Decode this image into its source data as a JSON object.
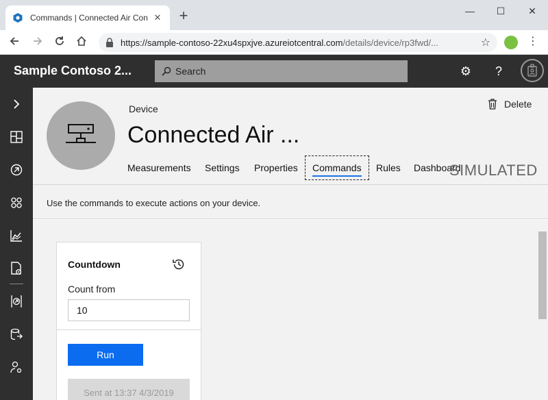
{
  "browser": {
    "tab_title": "Commands | Connected Air Conditioner",
    "new_tab_symbol": "+",
    "close_symbol": "✕",
    "url_host": "https://sample-contoso-22xu4spxjve.azureiotcentral.com",
    "url_path": "/details/device/rp3fwd/...",
    "window_controls": [
      "—",
      "☐",
      "✕"
    ]
  },
  "app": {
    "brand": "Sample Contoso 2...",
    "search_placeholder": "Search",
    "accent_color": "#0b6cf0",
    "header_bg": "#2f2f2f"
  },
  "rail": {
    "items": [
      "expand-icon",
      "dashboard-icon",
      "devices-icon",
      "device-sets-icon",
      "analytics-icon",
      "jobs-icon",
      "device-templates-icon",
      "data-export-icon",
      "administration-icon"
    ]
  },
  "device": {
    "type_label": "Device",
    "name": "Connected Air ...",
    "delete_label": "Delete",
    "badge": "SIMULATED",
    "tabs": [
      {
        "label": "Measurements",
        "active": false
      },
      {
        "label": "Settings",
        "active": false
      },
      {
        "label": "Properties",
        "active": false
      },
      {
        "label": "Commands",
        "active": true
      },
      {
        "label": "Rules",
        "active": false
      },
      {
        "label": "Dashboard",
        "active": false
      }
    ]
  },
  "commands": {
    "description": "Use the commands to execute actions on your device.",
    "card": {
      "title": "Countdown",
      "field_label": "Count from",
      "field_value": "10",
      "run_label": "Run",
      "status": "Sent at 13:37 4/3/2019"
    }
  }
}
